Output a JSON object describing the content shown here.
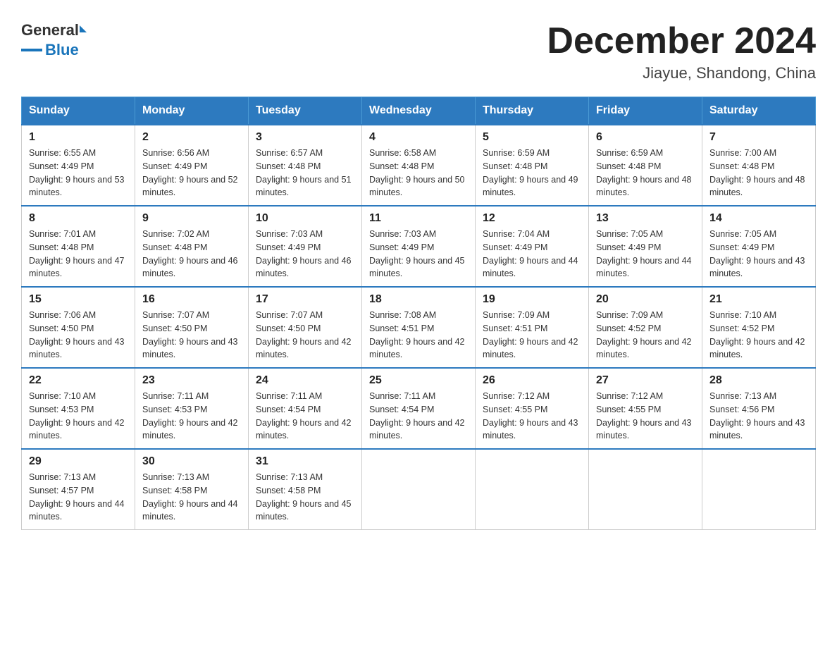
{
  "header": {
    "logo_general": "General",
    "logo_blue": "Blue",
    "month_title": "December 2024",
    "location": "Jiayue, Shandong, China"
  },
  "weekdays": [
    "Sunday",
    "Monday",
    "Tuesday",
    "Wednesday",
    "Thursday",
    "Friday",
    "Saturday"
  ],
  "weeks": [
    [
      {
        "day": "1",
        "sunrise": "6:55 AM",
        "sunset": "4:49 PM",
        "daylight": "9 hours and 53 minutes."
      },
      {
        "day": "2",
        "sunrise": "6:56 AM",
        "sunset": "4:49 PM",
        "daylight": "9 hours and 52 minutes."
      },
      {
        "day": "3",
        "sunrise": "6:57 AM",
        "sunset": "4:48 PM",
        "daylight": "9 hours and 51 minutes."
      },
      {
        "day": "4",
        "sunrise": "6:58 AM",
        "sunset": "4:48 PM",
        "daylight": "9 hours and 50 minutes."
      },
      {
        "day": "5",
        "sunrise": "6:59 AM",
        "sunset": "4:48 PM",
        "daylight": "9 hours and 49 minutes."
      },
      {
        "day": "6",
        "sunrise": "6:59 AM",
        "sunset": "4:48 PM",
        "daylight": "9 hours and 48 minutes."
      },
      {
        "day": "7",
        "sunrise": "7:00 AM",
        "sunset": "4:48 PM",
        "daylight": "9 hours and 48 minutes."
      }
    ],
    [
      {
        "day": "8",
        "sunrise": "7:01 AM",
        "sunset": "4:48 PM",
        "daylight": "9 hours and 47 minutes."
      },
      {
        "day": "9",
        "sunrise": "7:02 AM",
        "sunset": "4:48 PM",
        "daylight": "9 hours and 46 minutes."
      },
      {
        "day": "10",
        "sunrise": "7:03 AM",
        "sunset": "4:49 PM",
        "daylight": "9 hours and 46 minutes."
      },
      {
        "day": "11",
        "sunrise": "7:03 AM",
        "sunset": "4:49 PM",
        "daylight": "9 hours and 45 minutes."
      },
      {
        "day": "12",
        "sunrise": "7:04 AM",
        "sunset": "4:49 PM",
        "daylight": "9 hours and 44 minutes."
      },
      {
        "day": "13",
        "sunrise": "7:05 AM",
        "sunset": "4:49 PM",
        "daylight": "9 hours and 44 minutes."
      },
      {
        "day": "14",
        "sunrise": "7:05 AM",
        "sunset": "4:49 PM",
        "daylight": "9 hours and 43 minutes."
      }
    ],
    [
      {
        "day": "15",
        "sunrise": "7:06 AM",
        "sunset": "4:50 PM",
        "daylight": "9 hours and 43 minutes."
      },
      {
        "day": "16",
        "sunrise": "7:07 AM",
        "sunset": "4:50 PM",
        "daylight": "9 hours and 43 minutes."
      },
      {
        "day": "17",
        "sunrise": "7:07 AM",
        "sunset": "4:50 PM",
        "daylight": "9 hours and 42 minutes."
      },
      {
        "day": "18",
        "sunrise": "7:08 AM",
        "sunset": "4:51 PM",
        "daylight": "9 hours and 42 minutes."
      },
      {
        "day": "19",
        "sunrise": "7:09 AM",
        "sunset": "4:51 PM",
        "daylight": "9 hours and 42 minutes."
      },
      {
        "day": "20",
        "sunrise": "7:09 AM",
        "sunset": "4:52 PM",
        "daylight": "9 hours and 42 minutes."
      },
      {
        "day": "21",
        "sunrise": "7:10 AM",
        "sunset": "4:52 PM",
        "daylight": "9 hours and 42 minutes."
      }
    ],
    [
      {
        "day": "22",
        "sunrise": "7:10 AM",
        "sunset": "4:53 PM",
        "daylight": "9 hours and 42 minutes."
      },
      {
        "day": "23",
        "sunrise": "7:11 AM",
        "sunset": "4:53 PM",
        "daylight": "9 hours and 42 minutes."
      },
      {
        "day": "24",
        "sunrise": "7:11 AM",
        "sunset": "4:54 PM",
        "daylight": "9 hours and 42 minutes."
      },
      {
        "day": "25",
        "sunrise": "7:11 AM",
        "sunset": "4:54 PM",
        "daylight": "9 hours and 42 minutes."
      },
      {
        "day": "26",
        "sunrise": "7:12 AM",
        "sunset": "4:55 PM",
        "daylight": "9 hours and 43 minutes."
      },
      {
        "day": "27",
        "sunrise": "7:12 AM",
        "sunset": "4:55 PM",
        "daylight": "9 hours and 43 minutes."
      },
      {
        "day": "28",
        "sunrise": "7:13 AM",
        "sunset": "4:56 PM",
        "daylight": "9 hours and 43 minutes."
      }
    ],
    [
      {
        "day": "29",
        "sunrise": "7:13 AM",
        "sunset": "4:57 PM",
        "daylight": "9 hours and 44 minutes."
      },
      {
        "day": "30",
        "sunrise": "7:13 AM",
        "sunset": "4:58 PM",
        "daylight": "9 hours and 44 minutes."
      },
      {
        "day": "31",
        "sunrise": "7:13 AM",
        "sunset": "4:58 PM",
        "daylight": "9 hours and 45 minutes."
      },
      null,
      null,
      null,
      null
    ]
  ]
}
